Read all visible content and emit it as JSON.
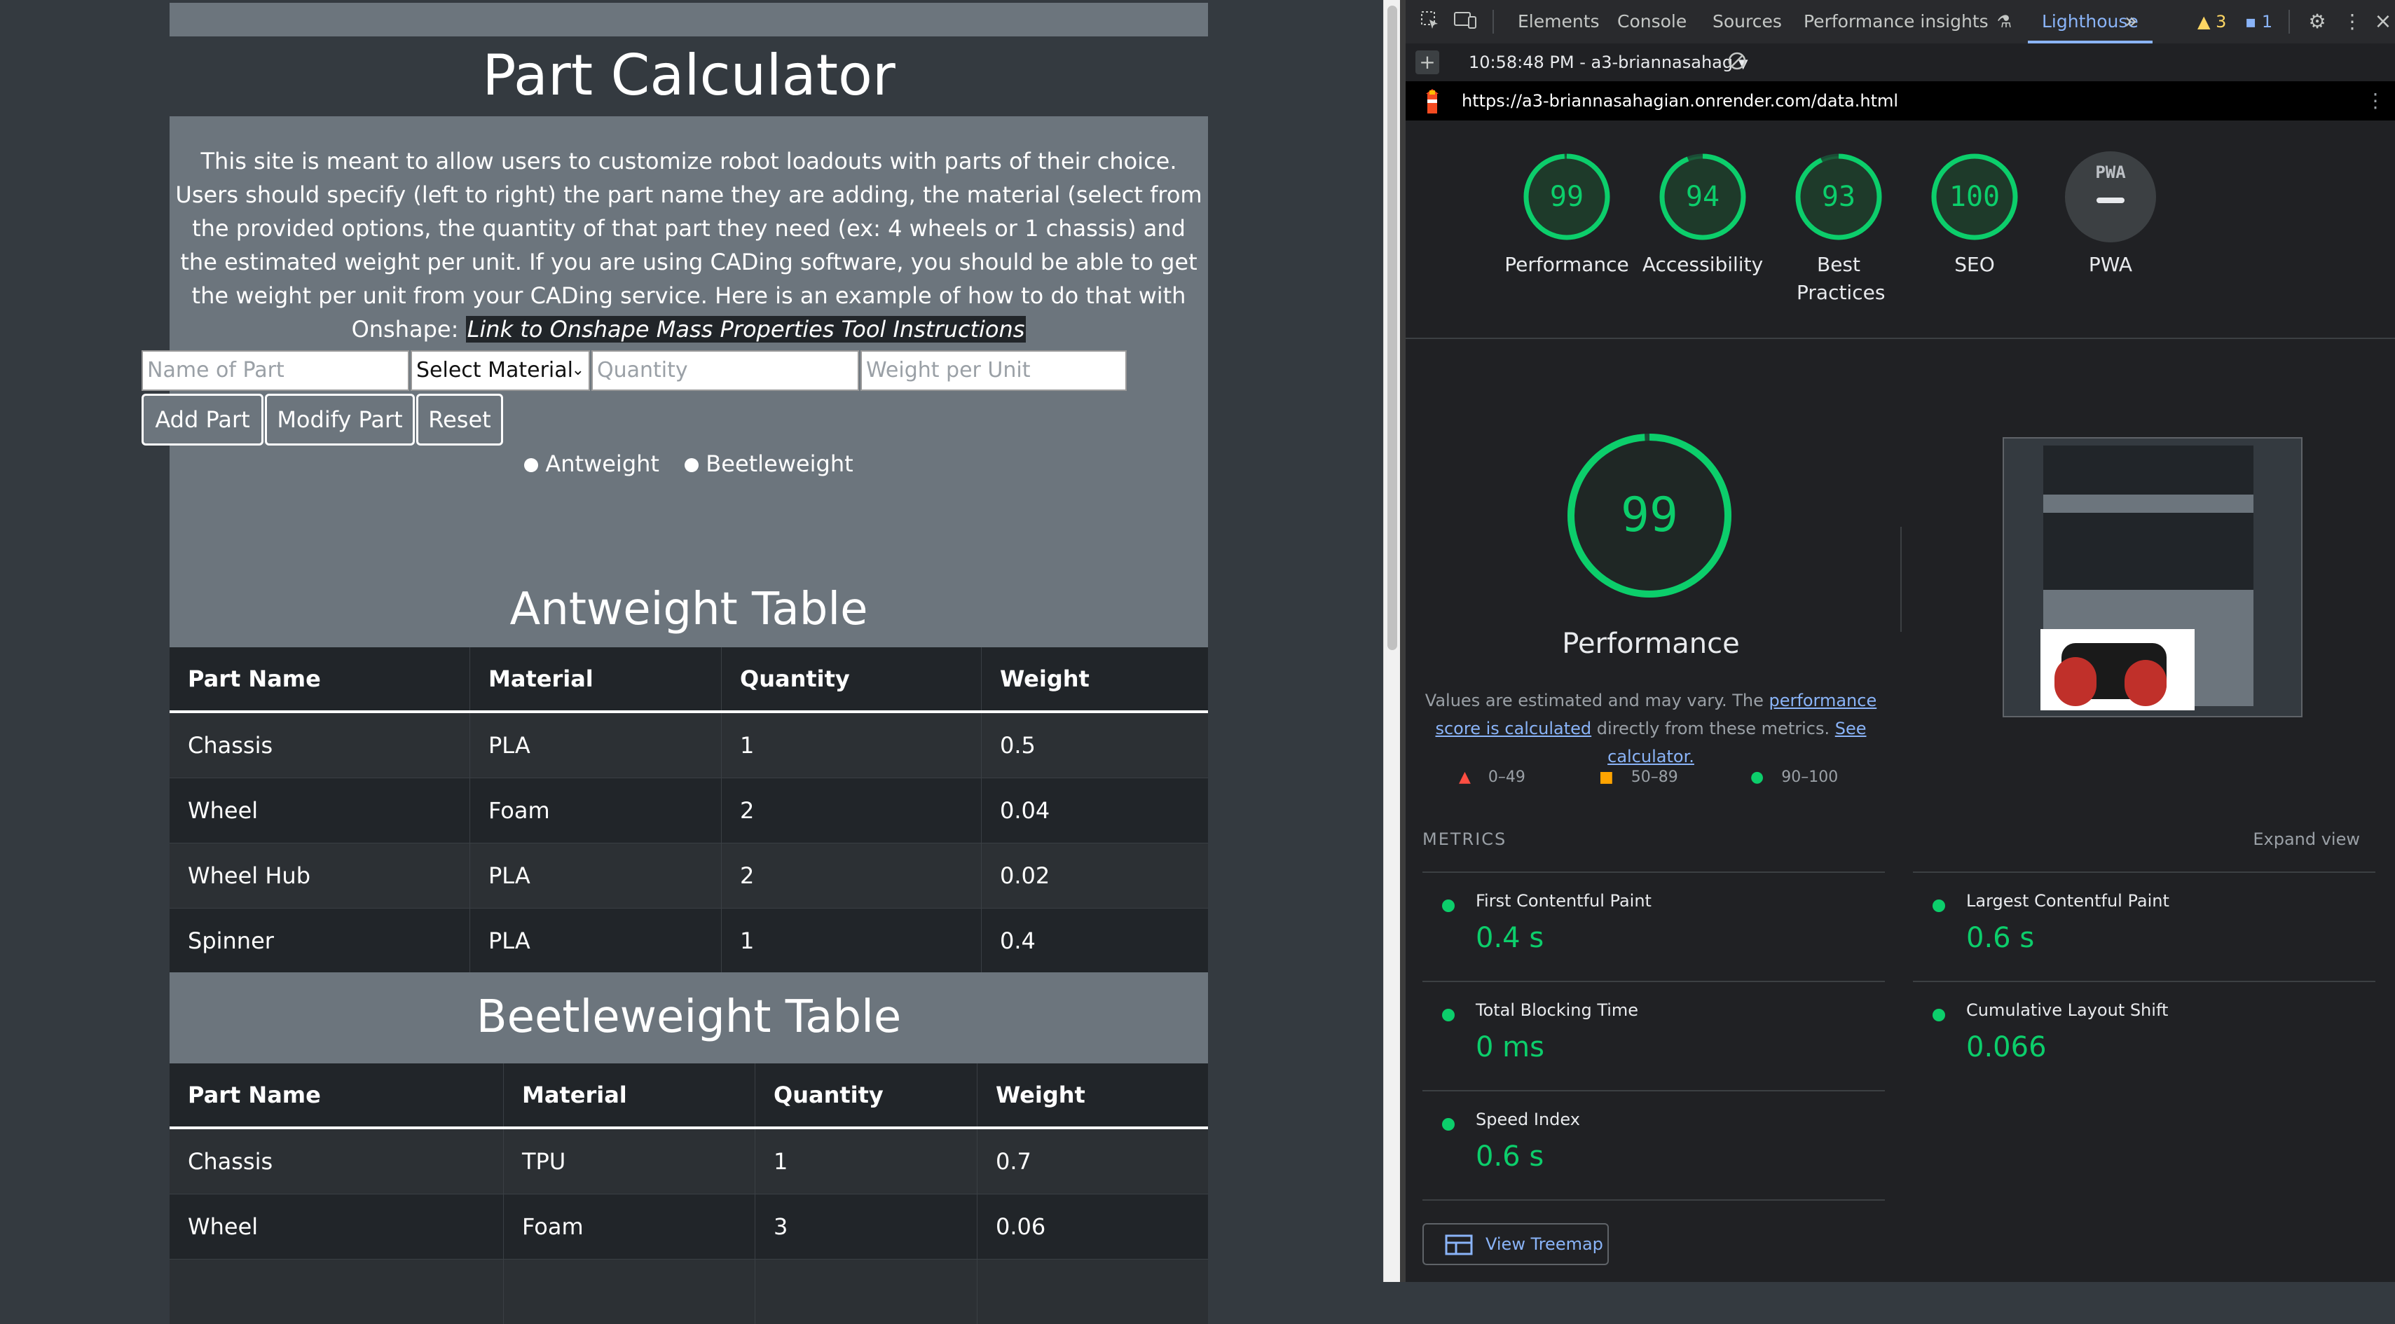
{
  "page": {
    "title": "Part Calculator",
    "description": "This site is meant to allow users to customize robot loadouts with parts of their choice. Users should specify (left to right) the part name they are adding, the material (select from the provided options, the quantity of that part they need (ex: 4 wheels or 1 chassis) and the estimated weight per unit. If you are using CADing software, you should be able to get the weight per unit from your CADing service. Here is an example of how to do that with Onshape:",
    "link_text": "Link to Onshape Mass Properties Tool Instructions",
    "inputs": {
      "part_name_placeholder": "Name of Part",
      "material_selected": "Select Material",
      "quantity_placeholder": "Quantity",
      "weight_placeholder": "Weight per Unit"
    },
    "buttons": {
      "add": "Add Part",
      "modify": "Modify Part",
      "reset": "Reset"
    },
    "radios": {
      "antweight": "Antweight",
      "beetleweight": "Beetleweight"
    },
    "antweight_table": {
      "title": "Antweight Table",
      "headers": [
        "Part Name",
        "Material",
        "Quantity",
        "Weight"
      ],
      "rows": [
        [
          "Chassis",
          "PLA",
          "1",
          "0.5"
        ],
        [
          "Wheel",
          "Foam",
          "2",
          "0.04"
        ],
        [
          "Wheel Hub",
          "PLA",
          "2",
          "0.02"
        ],
        [
          "Spinner",
          "PLA",
          "1",
          "0.4"
        ]
      ]
    },
    "beetleweight_table": {
      "title": "Beetleweight Table",
      "headers": [
        "Part Name",
        "Material",
        "Quantity",
        "Weight"
      ],
      "rows": [
        [
          "Chassis",
          "TPU",
          "1",
          "0.7"
        ],
        [
          "Wheel",
          "Foam",
          "3",
          "0.06"
        ]
      ]
    }
  },
  "devtools": {
    "tabs": [
      "Elements",
      "Console",
      "Sources",
      "Performance insights",
      "Lighthouse"
    ],
    "active_tab": "Lighthouse",
    "warnings_count": "3",
    "messages_count": "1",
    "report_selector": "10:58:48 PM - a3-briannasahag",
    "url": "https://a3-briannasahagian.onrender.com/data.html",
    "scores": [
      {
        "label": "Performance",
        "value": "99",
        "score": 0.99
      },
      {
        "label": "Accessibility",
        "value": "94",
        "score": 0.94
      },
      {
        "label": "Best Practices",
        "value": "93",
        "score": 0.93
      },
      {
        "label": "SEO",
        "value": "100",
        "score": 1.0
      },
      {
        "label": "PWA",
        "value": "PWA",
        "score": 0
      }
    ],
    "performance": {
      "score": "99",
      "title": "Performance",
      "note_prefix": "Values are estimated and may vary. The ",
      "note_link": "performance score is calculated",
      "note_mid": " directly from these metrics. ",
      "note_link2": "See calculator."
    },
    "legend": [
      "0–49",
      "50–89",
      "90–100"
    ],
    "metrics_heading": "METRICS",
    "expand_view": "Expand view",
    "metrics": [
      {
        "name": "First Contentful Paint",
        "value": "0.4 s"
      },
      {
        "name": "Largest Contentful Paint",
        "value": "0.6 s"
      },
      {
        "name": "Total Blocking Time",
        "value": "0 ms"
      },
      {
        "name": "Cumulative Layout Shift",
        "value": "0.066"
      },
      {
        "name": "Speed Index",
        "value": "0.6 s"
      }
    ],
    "view_treemap": "View Treemap",
    "colors": {
      "pass": "#0cce6b",
      "average": "#ffa400",
      "fail": "#ff4e42",
      "accent": "#8ab4f8"
    }
  }
}
